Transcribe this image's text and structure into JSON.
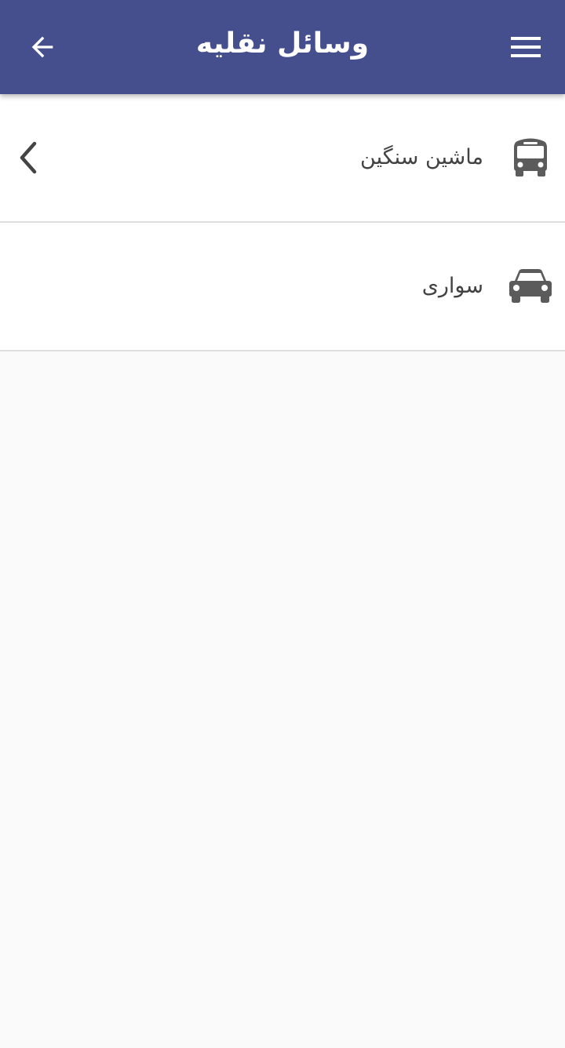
{
  "app_bar": {
    "title": "وسائل نقلیه",
    "background_color": "#464f8e",
    "back_icon": "arrow-left-icon",
    "menu_icon": "hamburger-menu-icon"
  },
  "list": {
    "items": [
      {
        "label": "ماشین سنگین",
        "icon": "bus-icon",
        "has_chevron": true
      },
      {
        "label": "سواری",
        "icon": "car-icon",
        "has_chevron": false
      }
    ]
  }
}
